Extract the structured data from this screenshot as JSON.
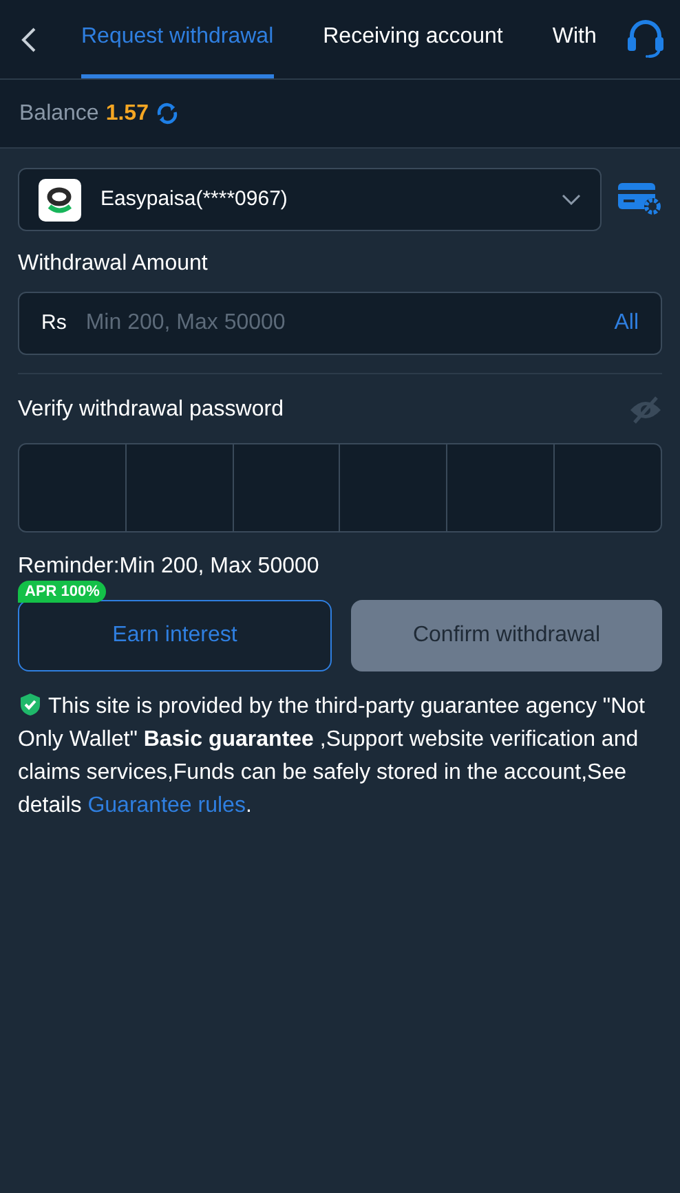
{
  "tabs": [
    {
      "label": "Request withdrawal",
      "selected": true
    },
    {
      "label": "Receiving account",
      "selected": false
    },
    {
      "label": "With",
      "selected": false
    }
  ],
  "balance": {
    "label": "Balance",
    "value": "1.57"
  },
  "account": {
    "name": "Easypaisa(****0967)"
  },
  "amount": {
    "label": "Withdrawal Amount",
    "currency": "Rs",
    "placeholder": "Min 200, Max 50000",
    "all_link": "All"
  },
  "password": {
    "label": "Verify withdrawal password",
    "visible": false
  },
  "reminder": "Reminder:Min 200, Max 50000",
  "earn": {
    "badge": "APR 100%",
    "label": "Earn interest"
  },
  "confirm": {
    "label": "Confirm withdrawal",
    "disabled": true
  },
  "notice": {
    "text": "This site is provided by the third-party guarantee agency \"Not Only Wallet\" **Basic guarantee** ,Support website verification and claims services,Funds can be safely stored in the account,See details ",
    "link": "Guarantee rules",
    "after": "."
  }
}
